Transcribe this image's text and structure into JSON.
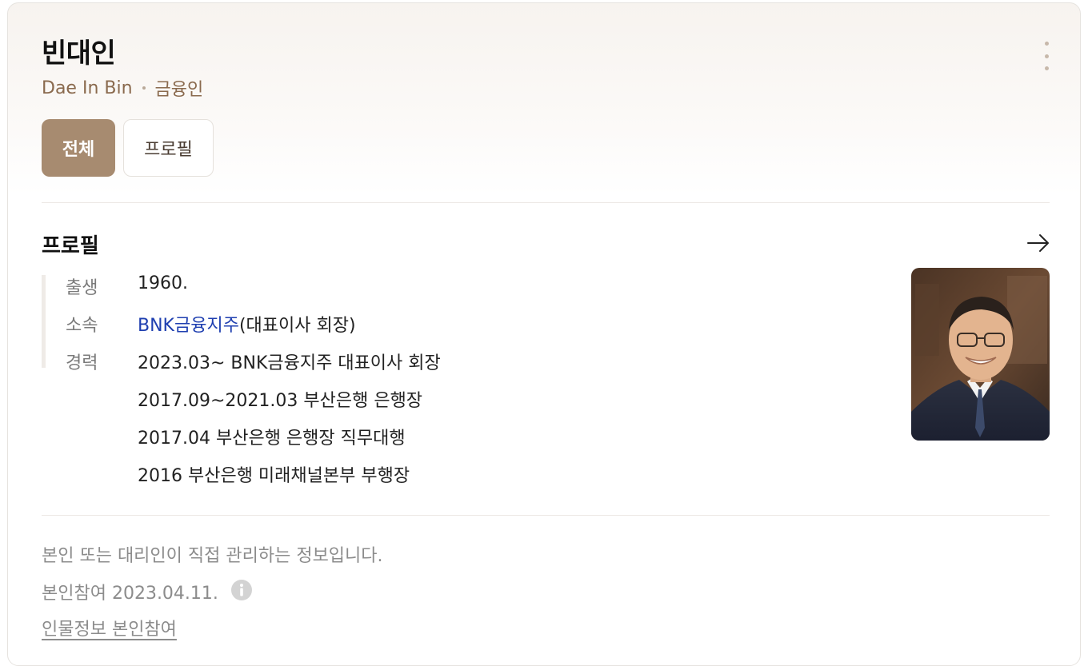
{
  "person": {
    "name": "빈대인",
    "english_name": "Dae In Bin",
    "occupation": "금융인"
  },
  "tabs": [
    {
      "label": "전체",
      "active": true
    },
    {
      "label": "프로필",
      "active": false
    }
  ],
  "profile": {
    "title": "프로필",
    "birth": {
      "label": "출생",
      "value": "1960."
    },
    "affiliation": {
      "label": "소속",
      "link_text": "BNK금융지주",
      "suffix": "(대표이사 회장)"
    },
    "career": {
      "label": "경력",
      "items": [
        "2023.03~ BNK금융지주 대표이사 회장",
        "2017.09~2021.03 부산은행 은행장",
        "2017.04 부산은행 은행장 직무대행",
        "2016 부산은행 미래채널본부 부행장"
      ]
    }
  },
  "footer": {
    "notice": "본인 또는 대리인이 직접 관리하는 정보입니다.",
    "participation": "본인참여 2023.04.11.",
    "link": "인물정보 본인참여"
  },
  "icons": {
    "more": "more-vertical-icon",
    "arrow": "arrow-right-icon",
    "info": "info-icon"
  },
  "colors": {
    "accent": "#a78b70",
    "subtitle": "#8a6a4e",
    "link": "#1f3fb0"
  }
}
